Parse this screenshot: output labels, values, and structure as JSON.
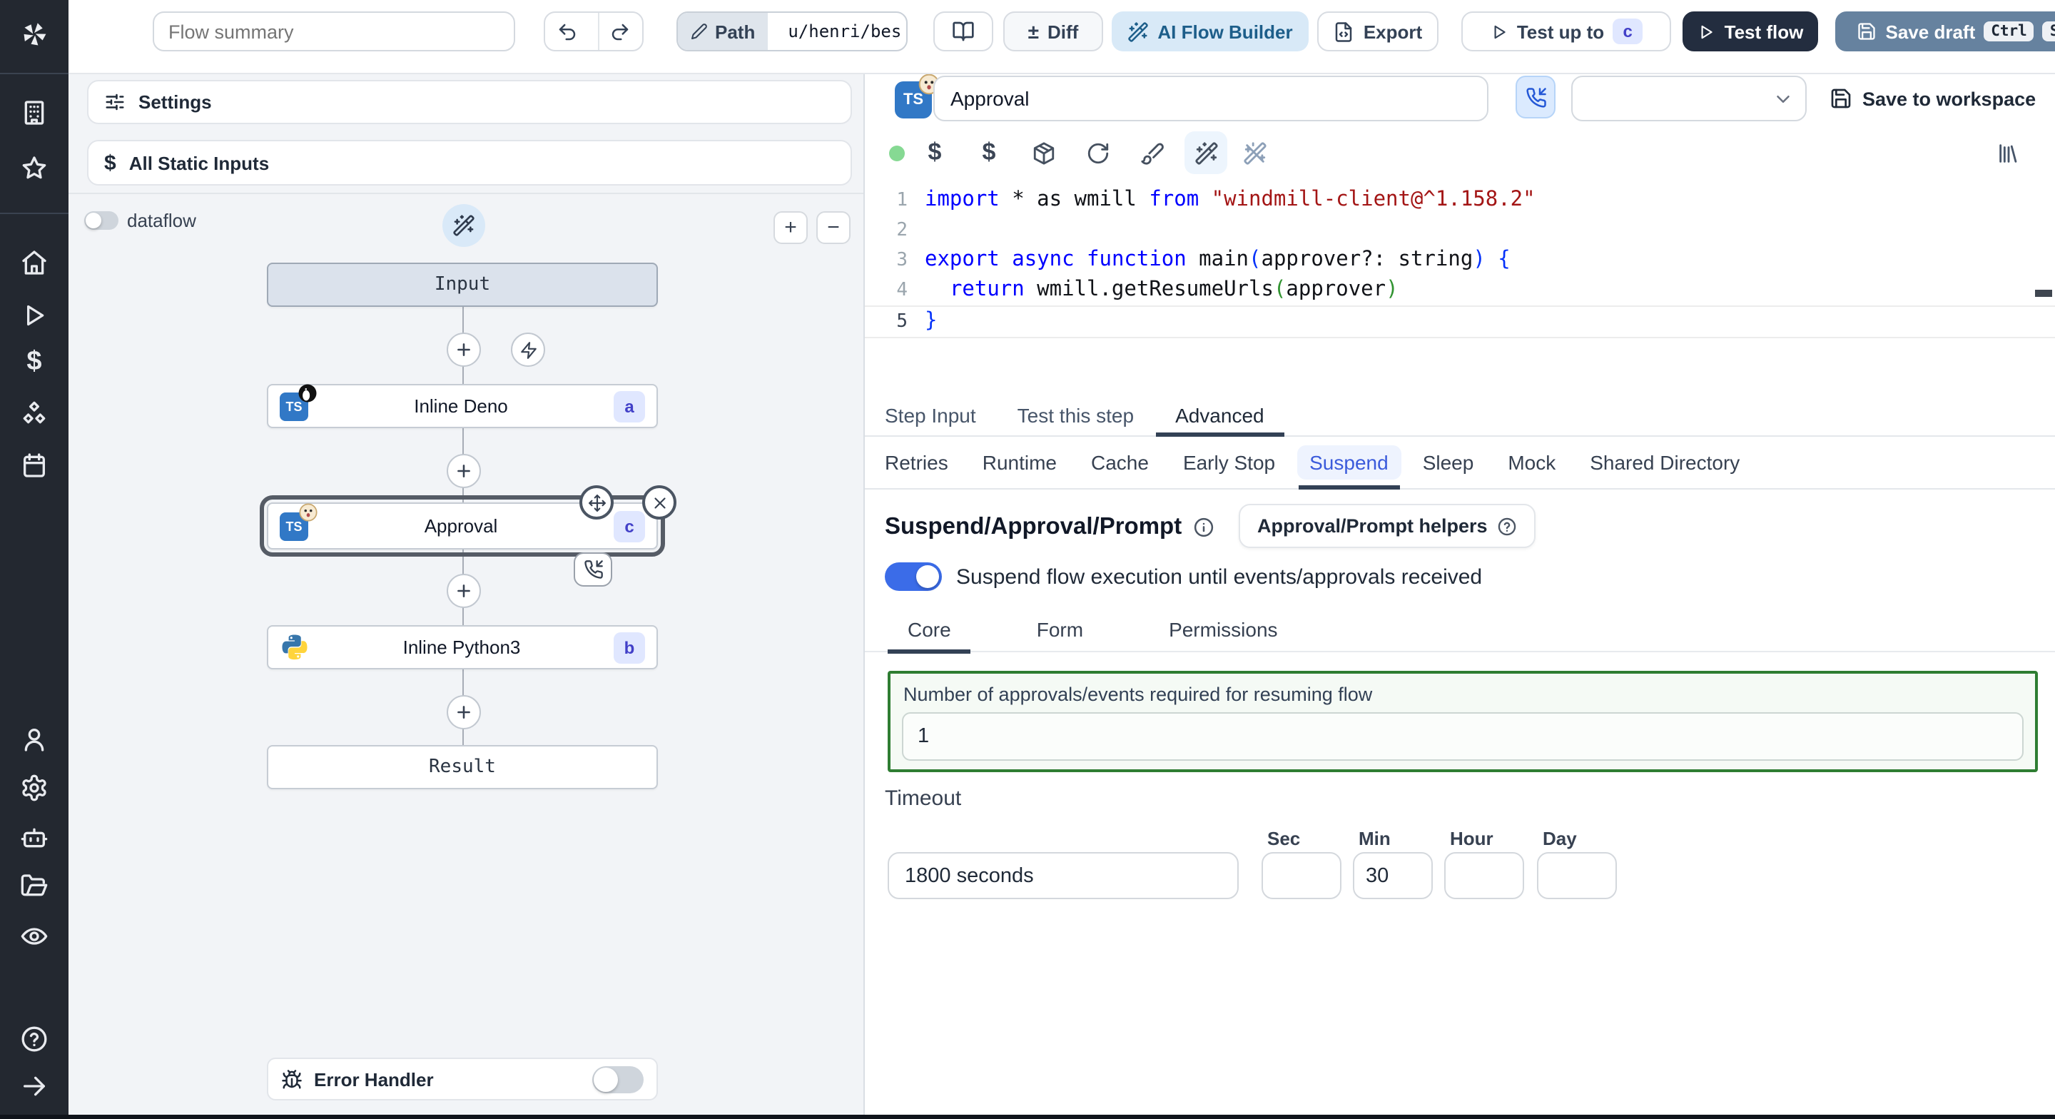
{
  "topbar": {
    "flow_summary_placeholder": "Flow summary",
    "path_label": "Path",
    "path_value": "u/henri/bes",
    "diff_label": "Diff",
    "ai_flow_builder_label": "AI Flow Builder",
    "export_label": "Export",
    "test_up_to_label": "Test up to",
    "test_up_to_badge": "c",
    "test_flow_label": "Test flow",
    "save_draft_label": "Save draft",
    "save_draft_kbd1": "Ctrl",
    "save_draft_kbd2": "S"
  },
  "icons": {
    "dollar": "$",
    "plus": "+",
    "minus": "−",
    "plus_minus": "±",
    "question": "?"
  },
  "flow_panel": {
    "settings_label": "Settings",
    "all_static_inputs_label": "All Static Inputs",
    "dataflow_label": "dataflow",
    "nodes": {
      "input_label": "Input",
      "deno_title": "Inline Deno",
      "deno_badge": "a",
      "approval_title": "Approval",
      "approval_badge": "c",
      "python_title": "Inline Python3",
      "python_badge": "b",
      "result_label": "Result"
    },
    "error_handler_label": "Error Handler"
  },
  "step_panel": {
    "language_badge": "TS",
    "name_value": "Approval",
    "save_to_workspace_label": "Save to workspace",
    "code": {
      "lines": [
        {
          "n": 1,
          "tokens": [
            [
              "kw",
              "import"
            ],
            [
              "pl",
              " * as wmill "
            ],
            [
              "kw",
              "from"
            ],
            [
              "pl",
              " "
            ],
            [
              "str",
              "\"windmill-client@^1.158.2\""
            ]
          ]
        },
        {
          "n": 2,
          "tokens": []
        },
        {
          "n": 3,
          "tokens": [
            [
              "kw",
              "export"
            ],
            [
              "pl",
              " "
            ],
            [
              "kw",
              "async"
            ],
            [
              "pl",
              " "
            ],
            [
              "kw",
              "function"
            ],
            [
              "pl",
              " main"
            ],
            [
              "brb",
              "("
            ],
            [
              "pl",
              "approver?: string"
            ],
            [
              "brb",
              ")"
            ],
            [
              "pl",
              " "
            ],
            [
              "brb",
              "{"
            ]
          ]
        },
        {
          "n": 4,
          "tokens": [
            [
              "pl",
              "  "
            ],
            [
              "kw",
              "return"
            ],
            [
              "pl",
              " wmill.getResumeUrls"
            ],
            [
              "brg",
              "("
            ],
            [
              "pl",
              "approver"
            ],
            [
              "brg",
              ")"
            ]
          ]
        },
        {
          "n": 5,
          "tokens": [
            [
              "brb",
              "}"
            ]
          ]
        }
      ]
    },
    "tabs": [
      {
        "label": "Step Input"
      },
      {
        "label": "Test this step"
      },
      {
        "label": "Advanced"
      }
    ],
    "advanced_tabs": [
      "Retries",
      "Runtime",
      "Cache",
      "Early Stop",
      "Suspend",
      "Sleep",
      "Mock",
      "Shared Directory"
    ],
    "suspend": {
      "heading": "Suspend/Approval/Prompt",
      "helpers_button_label": "Approval/Prompt helpers",
      "toggle_label": "Suspend flow execution until events/approvals received",
      "tabs": [
        "Core",
        "Form",
        "Permissions"
      ],
      "approvals_label": "Number of approvals/events required for resuming flow",
      "approvals_value": "1",
      "timeout_label": "Timeout",
      "timeout_display_value": "1800 seconds",
      "units": [
        {
          "label": "Sec",
          "value": ""
        },
        {
          "label": "Min",
          "value": "30"
        },
        {
          "label": "Hour",
          "value": ""
        },
        {
          "label": "Day",
          "value": ""
        }
      ]
    }
  },
  "colors": {
    "accent_blue": "#3b6ce8",
    "badge_bg": "#e0e7ff",
    "badge_text": "#4240c8",
    "green_border": "#2e7d32",
    "status_green": "#86d993",
    "save_draft_bg": "#66829f",
    "test_flow_bg": "#232d3f",
    "sidebar_bg": "#232830"
  }
}
